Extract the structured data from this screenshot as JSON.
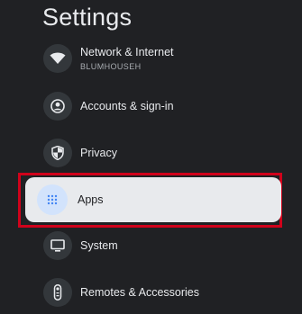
{
  "page_title": "Settings",
  "items": [
    {
      "label": "Network & Internet",
      "sublabel": "BLUMHOUSEH",
      "icon": "wifi-icon"
    },
    {
      "label": "Accounts & sign-in",
      "icon": "account-circle-icon"
    },
    {
      "label": "Privacy",
      "icon": "shield-icon"
    },
    {
      "label": "Apps",
      "icon": "apps-grid-icon",
      "selected": true
    },
    {
      "label": "System",
      "icon": "monitor-icon"
    },
    {
      "label": "Remotes & Accessories",
      "icon": "remote-icon"
    }
  ],
  "colors": {
    "background": "#202124",
    "selected_background": "#e8eaed",
    "highlight_border": "#d0021b",
    "selected_icon_bg": "#d2e3fc",
    "selected_icon": "#4285f4"
  }
}
